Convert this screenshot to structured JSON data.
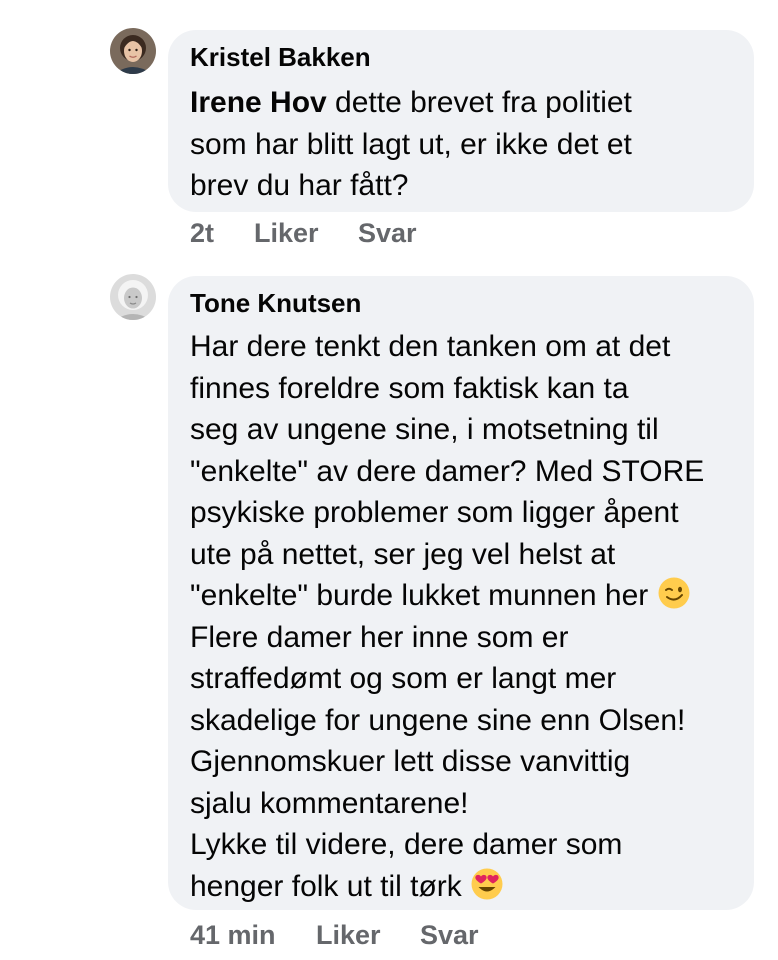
{
  "comments": [
    {
      "author": "Kristel Bakken",
      "mention": "Irene Hov",
      "text_lines": [
        " dette brevet fra politiet",
        "som har blitt lagt ut, er ikke det et",
        "brev du har fått?"
      ],
      "time": "2t",
      "like_label": "Liker",
      "reply_label": "Svar",
      "avatar_icon": "woman-portrait-avatar"
    },
    {
      "author": "Tone Knutsen",
      "text_lines": [
        "Har dere tenkt den tanken om at det",
        "finnes foreldre som faktisk kan ta",
        "seg av ungene sine, i motsetning til",
        "\"enkelte\" av dere damer? Med STORE",
        "psykiske problemer som ligger åpent",
        "ute på nettet, ser jeg vel helst at",
        "\"enkelte\" burde lukket munnen her ",
        "Flere damer her inne som er",
        "straffedømt og som er langt mer",
        "skadelige for ungene sine enn Olsen!",
        "Gjennomskuer lett disse vanvittig",
        "sjalu kommentarene!",
        "Lykke til videre, dere damer som",
        "henger folk ut til tørk "
      ],
      "emoji_1": "winking-face-emoji",
      "emoji_2": "heart-eyes-emoji",
      "time": "41 min",
      "like_label": "Liker",
      "reply_label": "Svar",
      "avatar_icon": "light-portrait-avatar"
    }
  ],
  "colors": {
    "bubble": "#f0f2f5",
    "meta_text": "#65676b",
    "body_text": "#050505",
    "emoji_yellow": "#ffcc4d",
    "heart_red": "#e0245e"
  }
}
